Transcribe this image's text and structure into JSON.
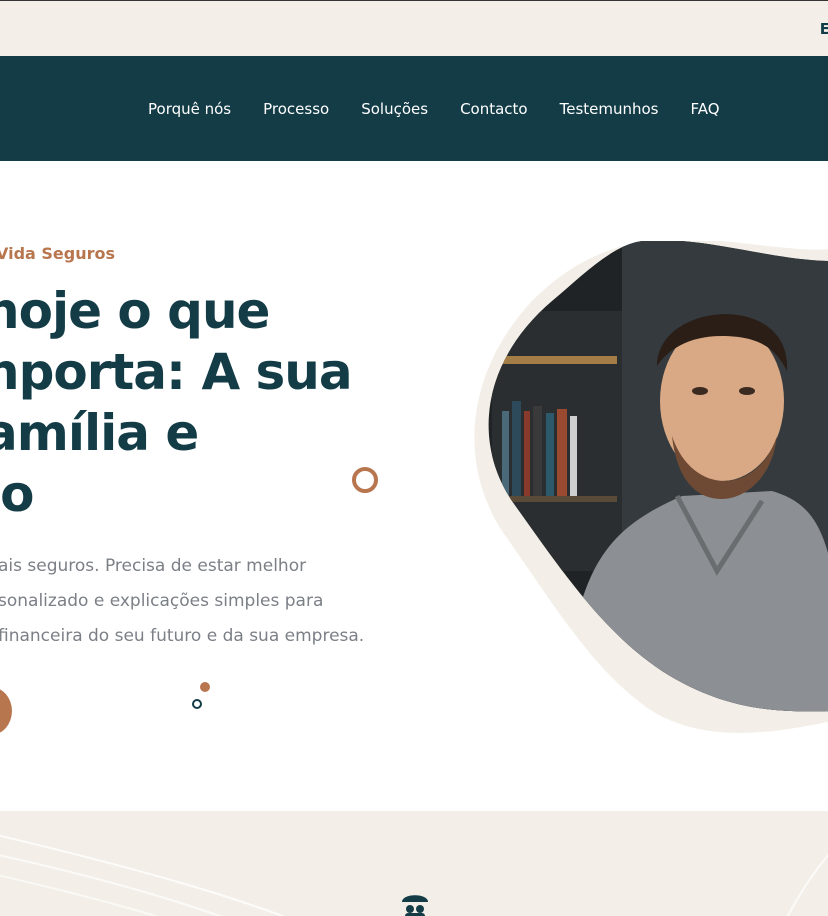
{
  "topbar": {
    "text": "E"
  },
  "nav": [
    {
      "label": "Porquê nós"
    },
    {
      "label": "Processo"
    },
    {
      "label": "Soluções"
    },
    {
      "label": "Contacto"
    },
    {
      "label": "Testemunhos"
    },
    {
      "label": "FAQ"
    }
  ],
  "hero": {
    "eyebrow": "Vida Seguros",
    "headline": [
      "hoje o que",
      "nporta: A sua",
      "amília e",
      "io"
    ],
    "paragraph": [
      "ais seguros. Precisa de estar melhor",
      "sonalizado e explicações simples para",
      "financeira do seu futuro e da sua empresa."
    ]
  },
  "colors": {
    "brand": "#133c47",
    "accent": "#b8764f",
    "cream": "#f3efe8"
  },
  "icons": {
    "bottom": "family-umbrella-icon"
  }
}
